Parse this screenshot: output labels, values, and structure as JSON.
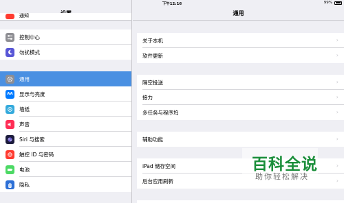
{
  "status_bar": {
    "device": "iPad",
    "time": "下午12:16",
    "battery_percent": "99%"
  },
  "master": {
    "title": "设置",
    "items": [
      {
        "label": "通知",
        "icon": "notifications-icon",
        "color": "#ff3b30",
        "selected": false
      },
      {
        "label": "控制中心",
        "icon": "control-center-icon",
        "color": "#8e8e93",
        "selected": false
      },
      {
        "label": "勿扰模式",
        "icon": "moon-icon",
        "color": "#5856d6",
        "selected": false
      },
      {
        "label": "通用",
        "icon": "gear-icon",
        "color": "#8e8e93",
        "selected": true
      },
      {
        "label": "显示与亮度",
        "icon": "display-icon",
        "color": "#007aff",
        "selected": false
      },
      {
        "label": "墙纸",
        "icon": "wallpaper-icon",
        "color": "#34aadc",
        "selected": false
      },
      {
        "label": "声音",
        "icon": "sound-icon",
        "color": "#ff2d55",
        "selected": false
      },
      {
        "label": "Siri 与搜索",
        "icon": "siri-icon",
        "color": "#1c1c3c",
        "selected": false
      },
      {
        "label": "触控 ID 与密码",
        "icon": "fingerprint-icon",
        "color": "#ff3b30",
        "selected": false
      },
      {
        "label": "电池",
        "icon": "battery-icon",
        "color": "#4cd964",
        "selected": false
      },
      {
        "label": "隐私",
        "icon": "privacy-hand-icon",
        "color": "#2c6fd6",
        "selected": false
      }
    ]
  },
  "detail": {
    "title": "通用",
    "items": [
      {
        "label": "关于本机"
      },
      {
        "label": "软件更新"
      },
      {
        "label": "隔空投送"
      },
      {
        "label": "接力"
      },
      {
        "label": "多任务与程序坞"
      },
      {
        "label": "辅助功能"
      },
      {
        "label": "iPad 储存空间"
      },
      {
        "label": "后台应用刷新"
      }
    ]
  },
  "watermark": {
    "main": "百科全说",
    "sub": "助你轻松解决"
  },
  "colors": {
    "selection": "#4a90e2",
    "background": "#efeff4",
    "watermark_green": "#1a8e3a"
  }
}
